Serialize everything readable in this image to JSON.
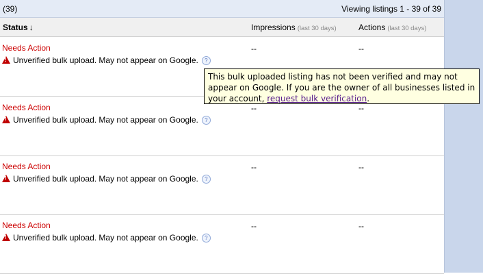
{
  "header": {
    "count": "(39)",
    "viewing": "Viewing listings 1 - 39 of 39"
  },
  "columns": {
    "status": "Status",
    "sort_arrow": "↓",
    "impressions": "Impressions",
    "impressions_sub": "(last 30 days)",
    "actions": "Actions",
    "actions_sub": "(last 30 days)"
  },
  "rows": [
    {
      "status": "Needs Action",
      "warning": "Unverified bulk upload. May not appear on Google.",
      "impressions": "--",
      "actions": "--"
    },
    {
      "status": "Needs Action",
      "warning": "Unverified bulk upload. May not appear on Google.",
      "impressions": "--",
      "actions": "--"
    },
    {
      "status": "Needs Action",
      "warning": "Unverified bulk upload. May not appear on Google.",
      "impressions": "--",
      "actions": "--"
    },
    {
      "status": "Needs Action",
      "warning": "Unverified bulk upload. May not appear on Google.",
      "impressions": "--",
      "actions": "--"
    }
  ],
  "icons": {
    "warning": "warning-triangle-icon",
    "help": "help-question-icon"
  },
  "colors": {
    "status_red": "#cc0000",
    "tooltip_bg": "#ffffe1",
    "link_visited": "#551a8b"
  },
  "tooltip": {
    "text_before": "This bulk uploaded listing has not been verified and may not appear on Google. If you are the owner of all businesses listed in your account,",
    "link": "request bulk verification",
    "text_after": "."
  }
}
